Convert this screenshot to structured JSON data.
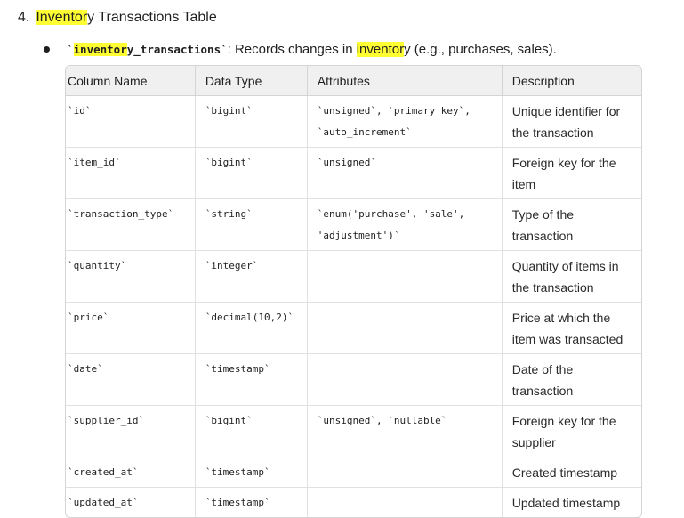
{
  "heading": {
    "number": "4.",
    "highlight": "Inventor",
    "rest": "y Transactions Table"
  },
  "bullet": {
    "code_tick_open": "`",
    "code_highlight": "inventor",
    "code_rest": "y_transactions",
    "code_tick_close": "`",
    "text_before": ": Records changes in ",
    "text_highlight": "inventor",
    "text_after": "y (e.g., purchases, sales)."
  },
  "table": {
    "headers": [
      "Column Name",
      "Data Type",
      "Attributes",
      "Description"
    ],
    "rows": [
      {
        "name": "`id`",
        "type": "`bigint`",
        "attr": "`unsigned`, `primary key`, `auto_increment`",
        "desc": "Unique identifier for the transaction"
      },
      {
        "name": "`item_id`",
        "type": "`bigint`",
        "attr": "`unsigned`",
        "desc": "Foreign key for the item"
      },
      {
        "name": "`transaction_type`",
        "type": "`string`",
        "attr": "`enum('purchase', 'sale', 'adjustment')`",
        "desc": "Type of the transaction"
      },
      {
        "name": "`quantity`",
        "type": "`integer`",
        "attr": "",
        "desc": "Quantity of items in the transaction"
      },
      {
        "name": "`price`",
        "type": "`decimal(10,2)`",
        "attr": "",
        "desc": "Price at which the item was transacted"
      },
      {
        "name": "`date`",
        "type": "`timestamp`",
        "attr": "",
        "desc": "Date of the transaction"
      },
      {
        "name": "`supplier_id`",
        "type": "`bigint`",
        "attr": "`unsigned`, `nullable`",
        "desc": "Foreign key for the supplier"
      },
      {
        "name": "`created_at`",
        "type": "`timestamp`",
        "attr": "",
        "desc": "Created timestamp"
      },
      {
        "name": "`updated_at`",
        "type": "`timestamp`",
        "attr": "",
        "desc": "Updated timestamp"
      }
    ]
  }
}
